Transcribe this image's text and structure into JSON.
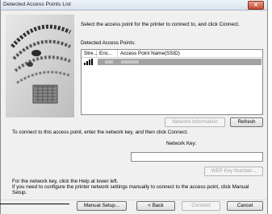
{
  "window": {
    "title": "Detected Access Points List",
    "close_label": "✕"
  },
  "instruction": "Select the access point for the printer to connect to, and click Connect.",
  "list": {
    "label": "Detected Access Points:",
    "columns": [
      "Stre...",
      "Enc...",
      "Access Point Name(SSID)"
    ],
    "selected_row_icon": "signal-strength-icon"
  },
  "buttons": {
    "network_information": "Network Information",
    "refresh": "Refresh",
    "wep_key_number": "WEP Key Number...",
    "manual_setup": "Manual Setup...",
    "back": "< Back",
    "connect": "Connect",
    "cancel": "Cancel"
  },
  "connect_text": "To connect to this access point, enter the network key, and then click Connect.",
  "network_key": {
    "label": "Network Key:",
    "value": ""
  },
  "help_text": {
    "line1": "For the network key, click the Help at lower left.",
    "line2": "If you need to configure the printer network settings manually to connect to the access point, click Manual",
    "line3": "Setup."
  }
}
